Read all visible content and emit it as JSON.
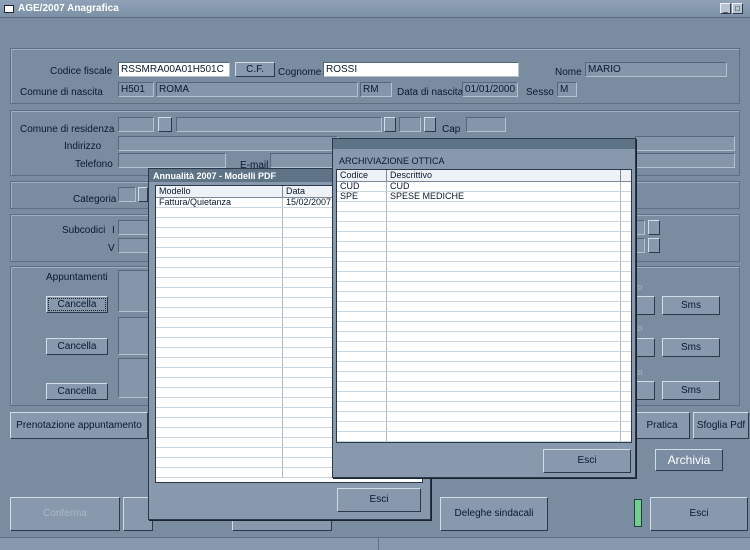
{
  "window": {
    "title": "AGE/2007 Anagrafica",
    "minimize": "_",
    "restore": "□"
  },
  "anagrafica": {
    "codice_fiscale_label": "Codice fiscale",
    "codice_fiscale": "RSSMRA00A01H501C",
    "cf_button": "C.F.",
    "cognome_label": "Cognome",
    "cognome": "ROSSI",
    "nome_label": "Nome",
    "nome": "MARIO",
    "comune_nascita_label": "Comune di nascita",
    "comune_nascita_code": "H501",
    "comune_nascita_name": "ROMA",
    "provincia": "RM",
    "data_nascita_label": "Data di nascita",
    "data_nascita": "01/01/2000",
    "sesso_label": "Sesso",
    "sesso": "M"
  },
  "residenza": {
    "comune_label": "Comune di residenza",
    "cap_label": "Cap",
    "indirizzo_label": "Indirizzo",
    "telefono_label": "Telefono",
    "email_label": "E-mail"
  },
  "categoria_label": "Categoria",
  "subcodici": {
    "label": "Subcodici",
    "i_label": "I",
    "v_label": "V"
  },
  "appuntamenti": {
    "label": "Appuntamenti",
    "cancella_label": "Cancella",
    "sms_label": "Sms",
    "faint_label": "ito"
  },
  "prenotazione_label": "Prenotazione appuntamento",
  "pratica_label": "Pratica",
  "sfoglia_label": "Sfoglia Pdf",
  "archivia_label": "Archivia",
  "bottom": {
    "conferma": "Conferma",
    "deleghe": "Deleghe sindacali",
    "esci": "Esci"
  },
  "modelli_dialog": {
    "title": "Annualità 2007 - Modelli PDF",
    "columns": [
      "Modello",
      "Data"
    ],
    "rows": [
      [
        "Fattura/Quietanza",
        "15/02/2007"
      ]
    ],
    "esci": "Esci"
  },
  "archiviazione_dialog": {
    "title": "ARCHIVIAZIONE OTTICA",
    "columns": [
      "Codice",
      "Descrittivo"
    ],
    "rows": [
      [
        "CUD",
        "CUD"
      ],
      [
        "SPE",
        "SPESE MEDICHE"
      ]
    ],
    "esci": "Esci"
  },
  "colors": {
    "background": "#7a8ca0",
    "titlebar": "#7c90a6",
    "accent_green": "#6fd28a"
  }
}
